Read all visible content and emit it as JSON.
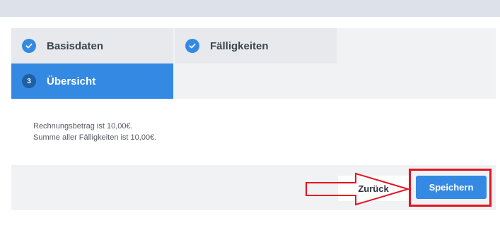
{
  "steps": [
    {
      "label": "Basisdaten",
      "state": "done",
      "icon": "check-icon"
    },
    {
      "label": "Fälligkeiten",
      "state": "done",
      "icon": "check-icon"
    },
    {
      "label": "Übersicht",
      "state": "active",
      "number": "3"
    }
  ],
  "summary": {
    "line1": "Rechnungsbetrag ist 10,00€.",
    "line2": "Summe aller Fälligkeiten ist 10,00€."
  },
  "footer": {
    "back_label": "Zurück",
    "save_label": "Speichern"
  },
  "colors": {
    "accent": "#3489e3",
    "highlight": "#e3141f",
    "panel": "#f1f2f4"
  }
}
